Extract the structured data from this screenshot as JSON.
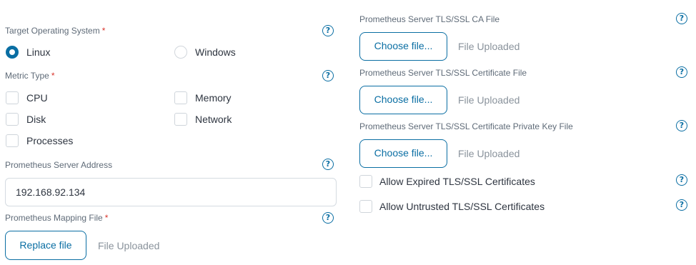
{
  "left": {
    "target_os": {
      "label": "Target Operating System",
      "required_mark": "*",
      "options": [
        {
          "label": "Linux",
          "selected": true
        },
        {
          "label": "Windows",
          "selected": false
        }
      ]
    },
    "metric_type": {
      "label": "Metric Type",
      "required_mark": "*",
      "options": [
        {
          "label": "CPU",
          "checked": false
        },
        {
          "label": "Memory",
          "checked": false
        },
        {
          "label": "Disk",
          "checked": false
        },
        {
          "label": "Network",
          "checked": false
        },
        {
          "label": "Processes",
          "checked": false
        }
      ]
    },
    "server_address": {
      "label": "Prometheus Server Address",
      "value": "192.168.92.134"
    },
    "mapping_file": {
      "label": "Prometheus Mapping File",
      "required_mark": "*",
      "button": "Replace file",
      "status": "File Uploaded"
    }
  },
  "right": {
    "ca_file": {
      "label": "Prometheus Server TLS/SSL CA File",
      "button": "Choose file...",
      "status": "File Uploaded"
    },
    "cert_file": {
      "label": "Prometheus Server TLS/SSL Certificate File",
      "button": "Choose file...",
      "status": "File Uploaded"
    },
    "key_file": {
      "label": "Prometheus Server TLS/SSL Certificate Private Key File",
      "button": "Choose file...",
      "status": "File Uploaded"
    },
    "allow_expired": {
      "label": "Allow Expired TLS/SSL Certificates",
      "checked": false
    },
    "allow_untrusted": {
      "label": "Allow Untrusted TLS/SSL Certificates",
      "checked": false
    }
  },
  "help_glyph": "?",
  "colors": {
    "accent": "#0a6ea3",
    "required": "#d9342b",
    "muted": "#8a939c"
  }
}
